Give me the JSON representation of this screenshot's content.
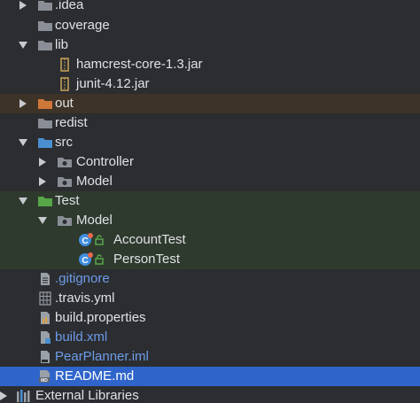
{
  "tree": {
    "items": [
      {
        "label": "idea",
        "prefix": ".",
        "icon": "folder-icon"
      },
      {
        "label": "coverage",
        "icon": "folder-icon"
      },
      {
        "label": "lib",
        "icon": "folder-icon"
      },
      {
        "label": "hamcrest-core-1.3.jar",
        "icon": "jar-icon"
      },
      {
        "label": "junit-4.12.jar",
        "icon": "jar-icon"
      },
      {
        "label": "out",
        "icon": "excluded-folder-icon"
      },
      {
        "label": "redist",
        "icon": "folder-icon"
      },
      {
        "label": "src",
        "icon": "source-folder-icon"
      },
      {
        "label": "Controller",
        "icon": "package-icon"
      },
      {
        "label": "Model",
        "icon": "package-icon"
      },
      {
        "label": "Test",
        "icon": "test-folder-icon"
      },
      {
        "label": "Model",
        "icon": "package-icon"
      },
      {
        "label": "AccountTest",
        "icon": "test-class-icon"
      },
      {
        "label": "PersonTest",
        "icon": "test-class-icon"
      },
      {
        "label": ".gitignore",
        "icon": "text-file-icon"
      },
      {
        "label": ".travis.yml",
        "icon": "yaml-file-icon"
      },
      {
        "label": "build.properties",
        "icon": "properties-file-icon"
      },
      {
        "label": "build.xml",
        "icon": "xml-file-icon"
      },
      {
        "label": "PearPlanner.iml",
        "icon": "iml-file-icon"
      },
      {
        "label": "README.md",
        "icon": "markdown-file-icon"
      },
      {
        "label": "External Libraries",
        "icon": "libraries-icon"
      }
    ]
  },
  "colors": {
    "background": "#2b2d30",
    "selection": "#2f65ca",
    "excluded_row": "#3d3326",
    "test_row": "#2f3a2e",
    "modified_text": "#6e9ce8"
  }
}
